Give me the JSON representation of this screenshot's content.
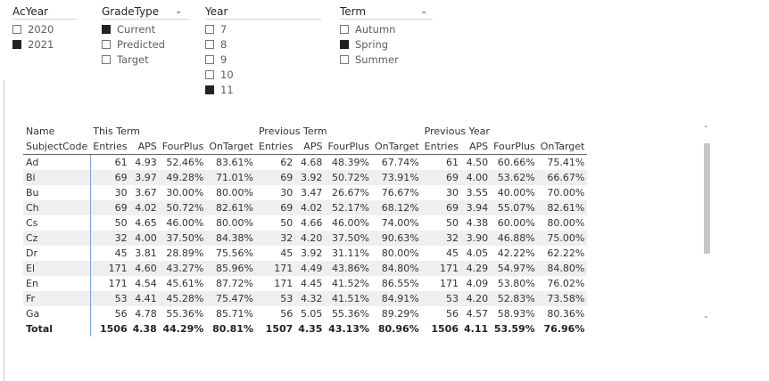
{
  "slicers": {
    "acyear": {
      "title": "AcYear",
      "options": [
        {
          "label": "2020",
          "checked": false
        },
        {
          "label": "2021",
          "checked": true
        }
      ]
    },
    "gradetype": {
      "title": "GradeType",
      "options": [
        {
          "label": "Current",
          "checked": true
        },
        {
          "label": "Predicted",
          "checked": false
        },
        {
          "label": "Target",
          "checked": false
        }
      ]
    },
    "year": {
      "title": "Year",
      "options": [
        {
          "label": "7",
          "checked": false
        },
        {
          "label": "8",
          "checked": false
        },
        {
          "label": "9",
          "checked": false
        },
        {
          "label": "10",
          "checked": false
        },
        {
          "label": "11",
          "checked": true
        }
      ]
    },
    "term": {
      "title": "Term",
      "options": [
        {
          "label": "Autumn",
          "checked": false
        },
        {
          "label": "Spring",
          "checked": true
        },
        {
          "label": "Summer",
          "checked": false
        }
      ]
    }
  },
  "matrix": {
    "row_header_1": "Name",
    "row_header_2": "SubjectCode",
    "groups": [
      "This Term",
      "Previous Term",
      "Previous Year"
    ],
    "measures": [
      "Entries",
      "APS",
      "FourPlus",
      "OnTarget"
    ],
    "rows": [
      {
        "code": "Ad",
        "values": [
          "61",
          "4.93",
          "52.46%",
          "83.61%",
          "62",
          "4.68",
          "48.39%",
          "67.74%",
          "61",
          "4.50",
          "60.66%",
          "75.41%"
        ]
      },
      {
        "code": "Bi",
        "values": [
          "69",
          "3.97",
          "49.28%",
          "71.01%",
          "69",
          "3.92",
          "50.72%",
          "73.91%",
          "69",
          "4.00",
          "53.62%",
          "66.67%"
        ]
      },
      {
        "code": "Bu",
        "values": [
          "30",
          "3.67",
          "30.00%",
          "80.00%",
          "30",
          "3.47",
          "26.67%",
          "76.67%",
          "30",
          "3.55",
          "40.00%",
          "70.00%"
        ]
      },
      {
        "code": "Ch",
        "values": [
          "69",
          "4.02",
          "50.72%",
          "82.61%",
          "69",
          "4.02",
          "52.17%",
          "68.12%",
          "69",
          "3.94",
          "55.07%",
          "82.61%"
        ]
      },
      {
        "code": "Cs",
        "values": [
          "50",
          "4.65",
          "46.00%",
          "80.00%",
          "50",
          "4.66",
          "46.00%",
          "74.00%",
          "50",
          "4.38",
          "60.00%",
          "80.00%"
        ]
      },
      {
        "code": "Cz",
        "values": [
          "32",
          "4.00",
          "37.50%",
          "84.38%",
          "32",
          "4.20",
          "37.50%",
          "90.63%",
          "32",
          "3.90",
          "46.88%",
          "75.00%"
        ]
      },
      {
        "code": "Dr",
        "values": [
          "45",
          "3.81",
          "28.89%",
          "75.56%",
          "45",
          "3.92",
          "31.11%",
          "80.00%",
          "45",
          "4.05",
          "42.22%",
          "62.22%"
        ]
      },
      {
        "code": "El",
        "values": [
          "171",
          "4.60",
          "43.27%",
          "85.96%",
          "171",
          "4.49",
          "43.86%",
          "84.80%",
          "171",
          "4.29",
          "54.97%",
          "84.80%"
        ]
      },
      {
        "code": "En",
        "values": [
          "171",
          "4.54",
          "45.61%",
          "87.72%",
          "171",
          "4.45",
          "41.52%",
          "86.55%",
          "171",
          "4.09",
          "53.80%",
          "76.02%"
        ]
      },
      {
        "code": "Fr",
        "values": [
          "53",
          "4.41",
          "45.28%",
          "75.47%",
          "53",
          "4.32",
          "41.51%",
          "84.91%",
          "53",
          "4.20",
          "52.83%",
          "73.58%"
        ]
      },
      {
        "code": "Ga",
        "values": [
          "56",
          "4.78",
          "55.36%",
          "85.71%",
          "56",
          "5.05",
          "55.36%",
          "89.29%",
          "56",
          "4.57",
          "58.93%",
          "80.36%"
        ]
      }
    ],
    "total": {
      "label": "Total",
      "values": [
        "1506",
        "4.38",
        "44.29%",
        "80.81%",
        "1507",
        "4.35",
        "43.13%",
        "80.96%",
        "1506",
        "4.11",
        "53.59%",
        "76.96%"
      ]
    }
  },
  "icons": {
    "chevron": "⌄",
    "scroll_up": "⌃",
    "scroll_down": "⌄"
  }
}
